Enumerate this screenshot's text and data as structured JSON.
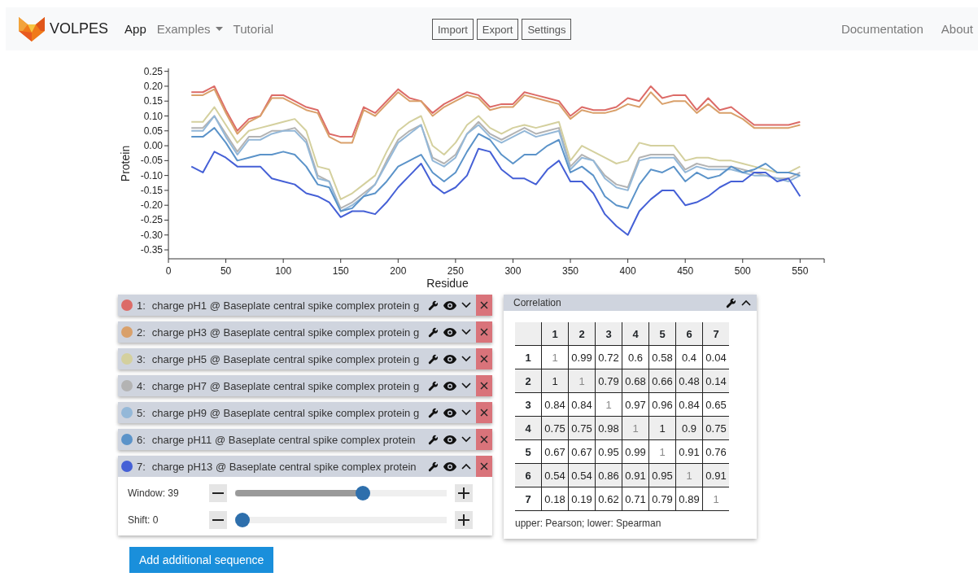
{
  "navbar": {
    "brand": "VOLPES",
    "links": [
      {
        "label": "App",
        "selected": true,
        "dropdown": false
      },
      {
        "label": "Examples",
        "selected": false,
        "dropdown": true
      },
      {
        "label": "Tutorial",
        "selected": false,
        "dropdown": false
      }
    ],
    "buttons": [
      "Import",
      "Export",
      "Settings"
    ],
    "right_links": [
      "Documentation",
      "About"
    ]
  },
  "chart": {
    "chart_data": {
      "type": "line",
      "xlabel": "Residue",
      "ylabel": "Protein",
      "xlim": [
        0,
        571
      ],
      "ylim": [
        -0.38,
        0.26
      ],
      "xticks": [
        0,
        50,
        100,
        150,
        200,
        250,
        300,
        350,
        400,
        450,
        500,
        550
      ],
      "yticks": [
        {
          "value": 0.25,
          "label": "0.25"
        },
        {
          "value": 0.2,
          "label": "0.20"
        },
        {
          "value": 0.15,
          "label": "0.15"
        },
        {
          "value": 0.1,
          "label": "0.10"
        },
        {
          "value": 0.05,
          "label": "0.05"
        },
        {
          "value": 0,
          "label": "0.00"
        },
        {
          "value": -0.05,
          "label": "-0.05"
        },
        {
          "value": -0.1,
          "label": "-0.10"
        },
        {
          "value": -0.15,
          "label": "-0.15"
        },
        {
          "value": -0.2,
          "label": "-0.20"
        },
        {
          "value": -0.25,
          "label": "-0.25"
        },
        {
          "value": -0.3,
          "label": "-0.30"
        },
        {
          "value": -0.35,
          "label": "-0.35"
        }
      ],
      "x": [
        20,
        30,
        40,
        50,
        60,
        70,
        80,
        90,
        100,
        110,
        120,
        130,
        140,
        150,
        160,
        170,
        180,
        190,
        200,
        210,
        220,
        230,
        240,
        250,
        260,
        270,
        280,
        290,
        300,
        310,
        320,
        330,
        340,
        350,
        360,
        370,
        380,
        390,
        400,
        410,
        420,
        430,
        440,
        450,
        460,
        470,
        480,
        490,
        500,
        510,
        520,
        530,
        540,
        550
      ],
      "series": [
        {
          "color": "#dc6b67",
          "values": [
            0.18,
            0.18,
            0.2,
            0.12,
            0.05,
            0.09,
            0.1,
            0.17,
            0.17,
            0.15,
            0.13,
            0.12,
            0.04,
            0.03,
            0.03,
            0.13,
            0.11,
            0.15,
            0.19,
            0.16,
            0.15,
            0.11,
            0.14,
            0.16,
            0.18,
            0.17,
            0.13,
            0.14,
            0.14,
            0.18,
            0.17,
            0.16,
            0.15,
            0.1,
            0.13,
            0.12,
            0.12,
            0.13,
            0.16,
            0.15,
            0.2,
            0.16,
            0.17,
            0.17,
            0.12,
            0.16,
            0.12,
            0.13,
            0.1,
            0.07,
            0.07,
            0.07,
            0.07,
            0.08
          ]
        },
        {
          "color": "#d9a06a",
          "values": [
            0.17,
            0.17,
            0.19,
            0.11,
            0.04,
            0.08,
            0.1,
            0.16,
            0.16,
            0.14,
            0.12,
            0.11,
            0.03,
            0.01,
            0.01,
            0.12,
            0.1,
            0.14,
            0.18,
            0.15,
            0.15,
            0.1,
            0.13,
            0.15,
            0.17,
            0.16,
            0.12,
            0.13,
            0.13,
            0.17,
            0.16,
            0.15,
            0.14,
            0.09,
            0.12,
            0.11,
            0.11,
            0.12,
            0.14,
            0.13,
            0.18,
            0.14,
            0.15,
            0.15,
            0.11,
            0.14,
            0.11,
            0.11,
            0.09,
            0.06,
            0.06,
            0.06,
            0.06,
            0.07
          ]
        },
        {
          "color": "#d4d09e",
          "values": [
            0.08,
            0.08,
            0.13,
            0.07,
            0.01,
            0.05,
            0.06,
            0.07,
            0.08,
            0.09,
            0.05,
            -0.07,
            -0.08,
            -0.18,
            -0.16,
            -0.13,
            -0.1,
            -0.02,
            0.05,
            0.08,
            0.1,
            0,
            -0.03,
            0.01,
            0.07,
            0.1,
            0.06,
            0.04,
            0.06,
            0.07,
            0.06,
            0.07,
            0.08,
            -0.05,
            0,
            -0.02,
            -0.04,
            -0.06,
            -0.05,
            0.01,
            0,
            0,
            0,
            -0.05,
            -0.04,
            -0.04,
            -0.05,
            -0.05,
            -0.06,
            -0.07,
            -0.08,
            -0.09,
            -0.09,
            -0.07
          ]
        },
        {
          "color": "#b3b3b3",
          "values": [
            0.06,
            0.06,
            0.1,
            0.04,
            -0.02,
            0.03,
            0.03,
            0.05,
            0.05,
            0.06,
            0.02,
            -0.1,
            -0.12,
            -0.21,
            -0.19,
            -0.16,
            -0.13,
            -0.05,
            0.02,
            0.05,
            0.07,
            -0.04,
            -0.06,
            -0.03,
            0.04,
            0.08,
            0.04,
            0.02,
            0.04,
            0.06,
            0.04,
            0.05,
            0.06,
            -0.07,
            -0.03,
            -0.05,
            -0.1,
            -0.13,
            -0.14,
            -0.04,
            -0.03,
            -0.03,
            -0.03,
            -0.08,
            -0.06,
            -0.07,
            -0.07,
            -0.07,
            -0.08,
            -0.09,
            -0.1,
            -0.11,
            -0.11,
            -0.09
          ]
        },
        {
          "color": "#94b8d8",
          "values": [
            0.05,
            0.05,
            0.1,
            0.03,
            -0.03,
            0.02,
            0.02,
            0.04,
            0.05,
            0.05,
            0.01,
            -0.11,
            -0.12,
            -0.22,
            -0.2,
            -0.17,
            -0.13,
            -0.06,
            0.01,
            0.04,
            0.07,
            -0.05,
            -0.07,
            -0.04,
            0.04,
            0.07,
            0.03,
            0.01,
            0.03,
            0.05,
            0.03,
            0.04,
            0.05,
            -0.08,
            -0.04,
            -0.05,
            -0.11,
            -0.14,
            -0.15,
            -0.05,
            -0.04,
            -0.04,
            -0.04,
            -0.09,
            -0.07,
            -0.08,
            -0.08,
            -0.08,
            -0.09,
            -0.1,
            -0.1,
            -0.11,
            -0.12,
            -0.1
          ]
        },
        {
          "color": "#5b93c9",
          "values": [
            0.03,
            0.03,
            0.06,
            0.01,
            -0.05,
            -0.04,
            -0.03,
            -0.03,
            -0.02,
            -0.03,
            -0.07,
            -0.13,
            -0.14,
            -0.22,
            -0.21,
            -0.17,
            -0.16,
            -0.12,
            -0.07,
            -0.05,
            -0.03,
            -0.09,
            -0.12,
            -0.09,
            -0.02,
            0.04,
            0.02,
            -0.03,
            -0.06,
            -0.03,
            -0.03,
            0,
            0.02,
            -0.09,
            -0.07,
            -0.1,
            -0.17,
            -0.2,
            -0.21,
            -0.13,
            -0.08,
            -0.09,
            -0.07,
            -0.12,
            -0.09,
            -0.11,
            -0.1,
            -0.07,
            -0.09,
            -0.08,
            -0.06,
            -0.09,
            -0.09,
            -0.1
          ]
        },
        {
          "color": "#4560d6",
          "values": [
            -0.07,
            -0.09,
            -0.02,
            -0.04,
            -0.07,
            -0.07,
            -0.07,
            -0.11,
            -0.12,
            -0.13,
            -0.16,
            -0.17,
            -0.19,
            -0.24,
            -0.22,
            -0.22,
            -0.23,
            -0.19,
            -0.14,
            -0.1,
            -0.06,
            -0.13,
            -0.16,
            -0.14,
            -0.1,
            -0.01,
            -0.02,
            -0.08,
            -0.11,
            -0.11,
            -0.13,
            -0.08,
            -0.05,
            -0.12,
            -0.12,
            -0.16,
            -0.23,
            -0.27,
            -0.3,
            -0.22,
            -0.18,
            -0.15,
            -0.15,
            -0.2,
            -0.19,
            -0.17,
            -0.14,
            -0.12,
            -0.12,
            -0.09,
            -0.09,
            -0.12,
            -0.11,
            -0.17
          ]
        }
      ]
    }
  },
  "sequences": [
    {
      "number": "1:",
      "title": "charge pH1 @ Baseplate central spike complex protein g",
      "color": "#dc6b67",
      "expanded": false
    },
    {
      "number": "2:",
      "title": "charge pH3 @ Baseplate central spike complex protein g",
      "color": "#d9a06a",
      "expanded": false
    },
    {
      "number": "3:",
      "title": "charge pH5 @ Baseplate central spike complex protein g",
      "color": "#d4d09e",
      "expanded": false
    },
    {
      "number": "4:",
      "title": "charge pH7 @ Baseplate central spike complex protein g",
      "color": "#b3b3b3",
      "expanded": false
    },
    {
      "number": "5:",
      "title": "charge pH9 @ Baseplate central spike complex protein g",
      "color": "#94b8d8",
      "expanded": false
    },
    {
      "number": "6:",
      "title": "charge pH11 @ Baseplate central spike complex protein",
      "color": "#5b93c9",
      "expanded": false
    },
    {
      "number": "7:",
      "title": "charge pH13 @ Baseplate central spike complex protein",
      "color": "#4560d6",
      "expanded": true,
      "sliders": [
        {
          "label": "Window: 39",
          "level": 0.61
        },
        {
          "label": "Shift: 0",
          "level": 0
        }
      ]
    }
  ],
  "add_button": "Add additional sequence",
  "correlation": {
    "title": "Correlation",
    "expanded": true,
    "columns": [
      "1",
      "2",
      "3",
      "4",
      "5",
      "6",
      "7"
    ],
    "rows": [
      {
        "label": "1",
        "cells": [
          "1",
          "0.99",
          "0.72",
          "0.6",
          "0.58",
          "0.4",
          "0.04"
        ]
      },
      {
        "label": "2",
        "cells": [
          "1",
          "1",
          "0.79",
          "0.68",
          "0.66",
          "0.48",
          "0.14"
        ]
      },
      {
        "label": "3",
        "cells": [
          "0.84",
          "0.84",
          "1",
          "0.97",
          "0.96",
          "0.84",
          "0.65"
        ]
      },
      {
        "label": "4",
        "cells": [
          "0.75",
          "0.75",
          "0.98",
          "1",
          "1",
          "0.9",
          "0.75"
        ]
      },
      {
        "label": "5",
        "cells": [
          "0.67",
          "0.67",
          "0.95",
          "0.99",
          "1",
          "0.91",
          "0.76"
        ]
      },
      {
        "label": "6",
        "cells": [
          "0.54",
          "0.54",
          "0.86",
          "0.91",
          "0.95",
          "1",
          "0.91"
        ]
      },
      {
        "label": "7",
        "cells": [
          "0.18",
          "0.19",
          "0.62",
          "0.71",
          "0.79",
          "0.89",
          "1"
        ]
      }
    ],
    "note": "upper: Pearson; lower: Spearman"
  }
}
